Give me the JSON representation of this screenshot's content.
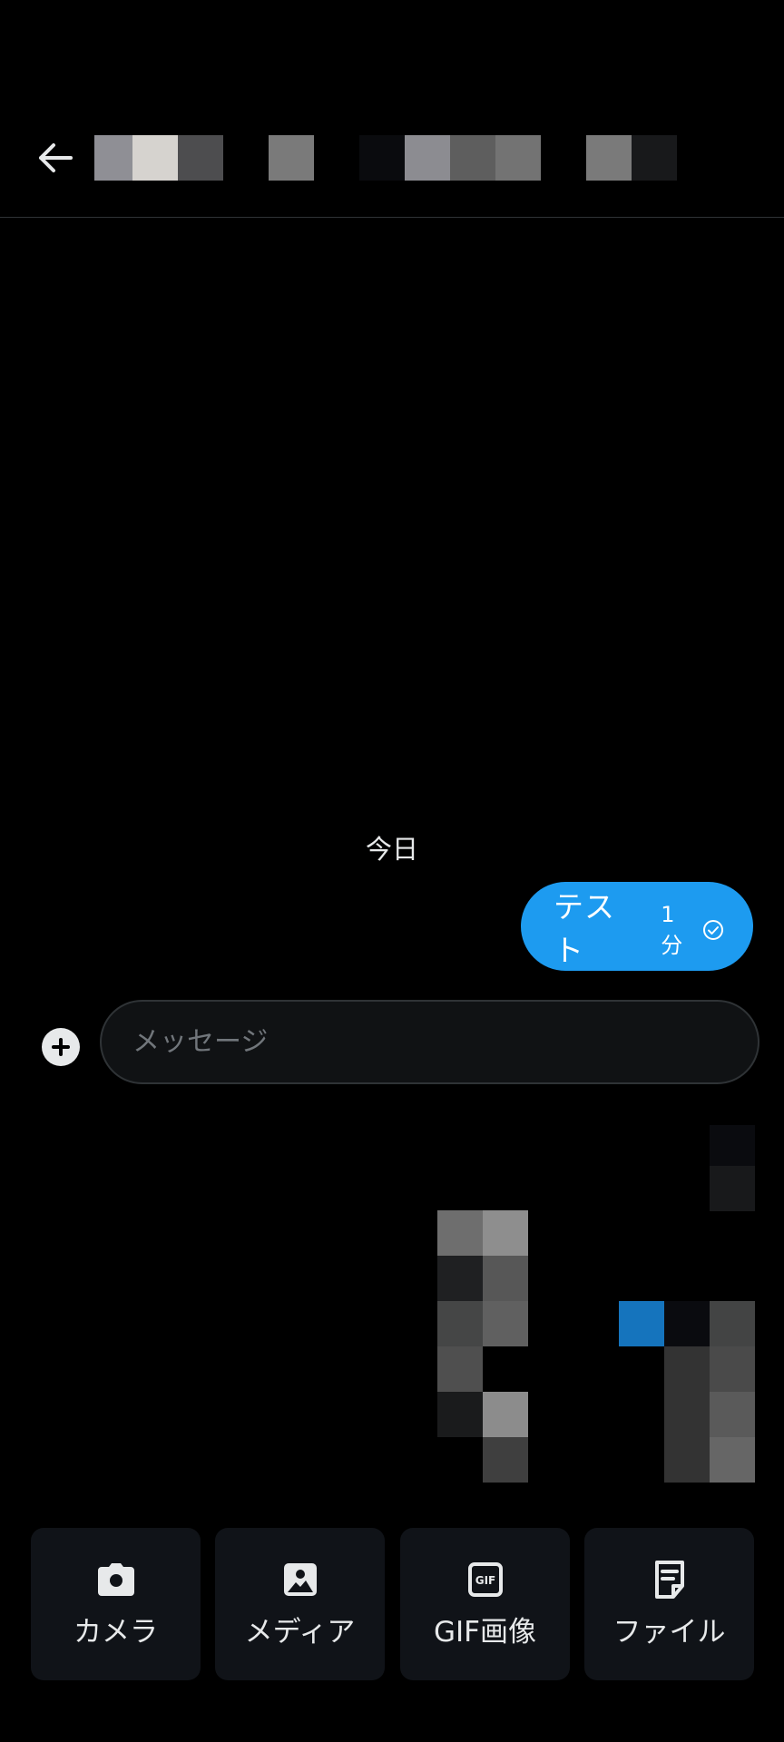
{
  "header": {
    "back_icon": "arrow-left-icon"
  },
  "chat": {
    "date_label": "今日",
    "messages": [
      {
        "text": "テスト",
        "time": "1分",
        "status_icon": "check-circle-icon"
      }
    ]
  },
  "composer": {
    "plus_icon": "plus-circle-icon",
    "placeholder": "メッセージ"
  },
  "attachments": [
    {
      "label": "カメラ",
      "icon": "camera-icon"
    },
    {
      "label": "メディア",
      "icon": "image-icon"
    },
    {
      "label": "GIF画像",
      "icon": "gif-icon"
    },
    {
      "label": "ファイル",
      "icon": "file-icon"
    }
  ],
  "colors": {
    "background": "#000000",
    "bubble": "#1d9bf0",
    "tile": "#101318",
    "text": "#e7e9ea",
    "placeholder": "#71767b"
  }
}
